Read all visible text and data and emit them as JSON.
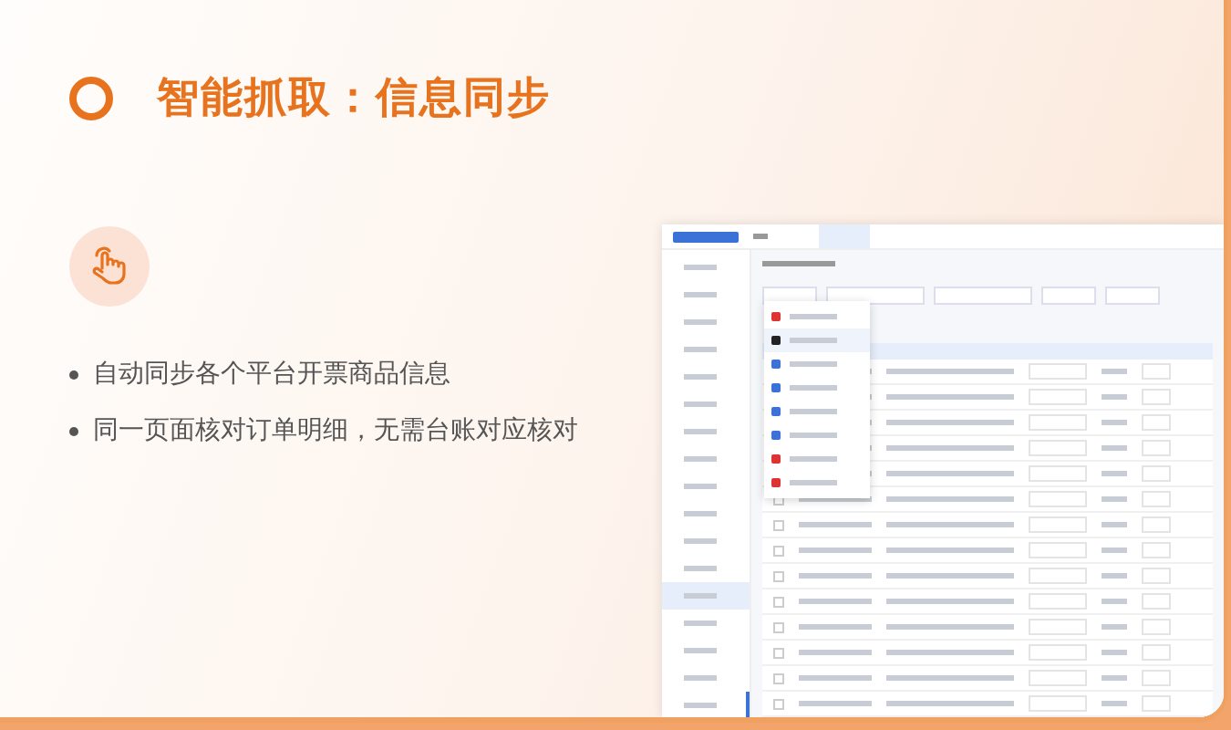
{
  "title": "智能抓取：信息同步",
  "bullets": [
    "自动同步各个平台开票商品信息",
    "同一页面核对订单明细，无需台账对应核对"
  ],
  "screenshot": {
    "kind": "picture",
    "rows": [
      {
        "checked": false
      },
      {
        "checked": false
      },
      {
        "checked": false
      },
      {
        "checked": false
      },
      {
        "checked": false
      },
      {
        "checked": false
      },
      {
        "checked": false
      },
      {
        "checked": false
      },
      {
        "checked": false
      }
    ]
  }
}
